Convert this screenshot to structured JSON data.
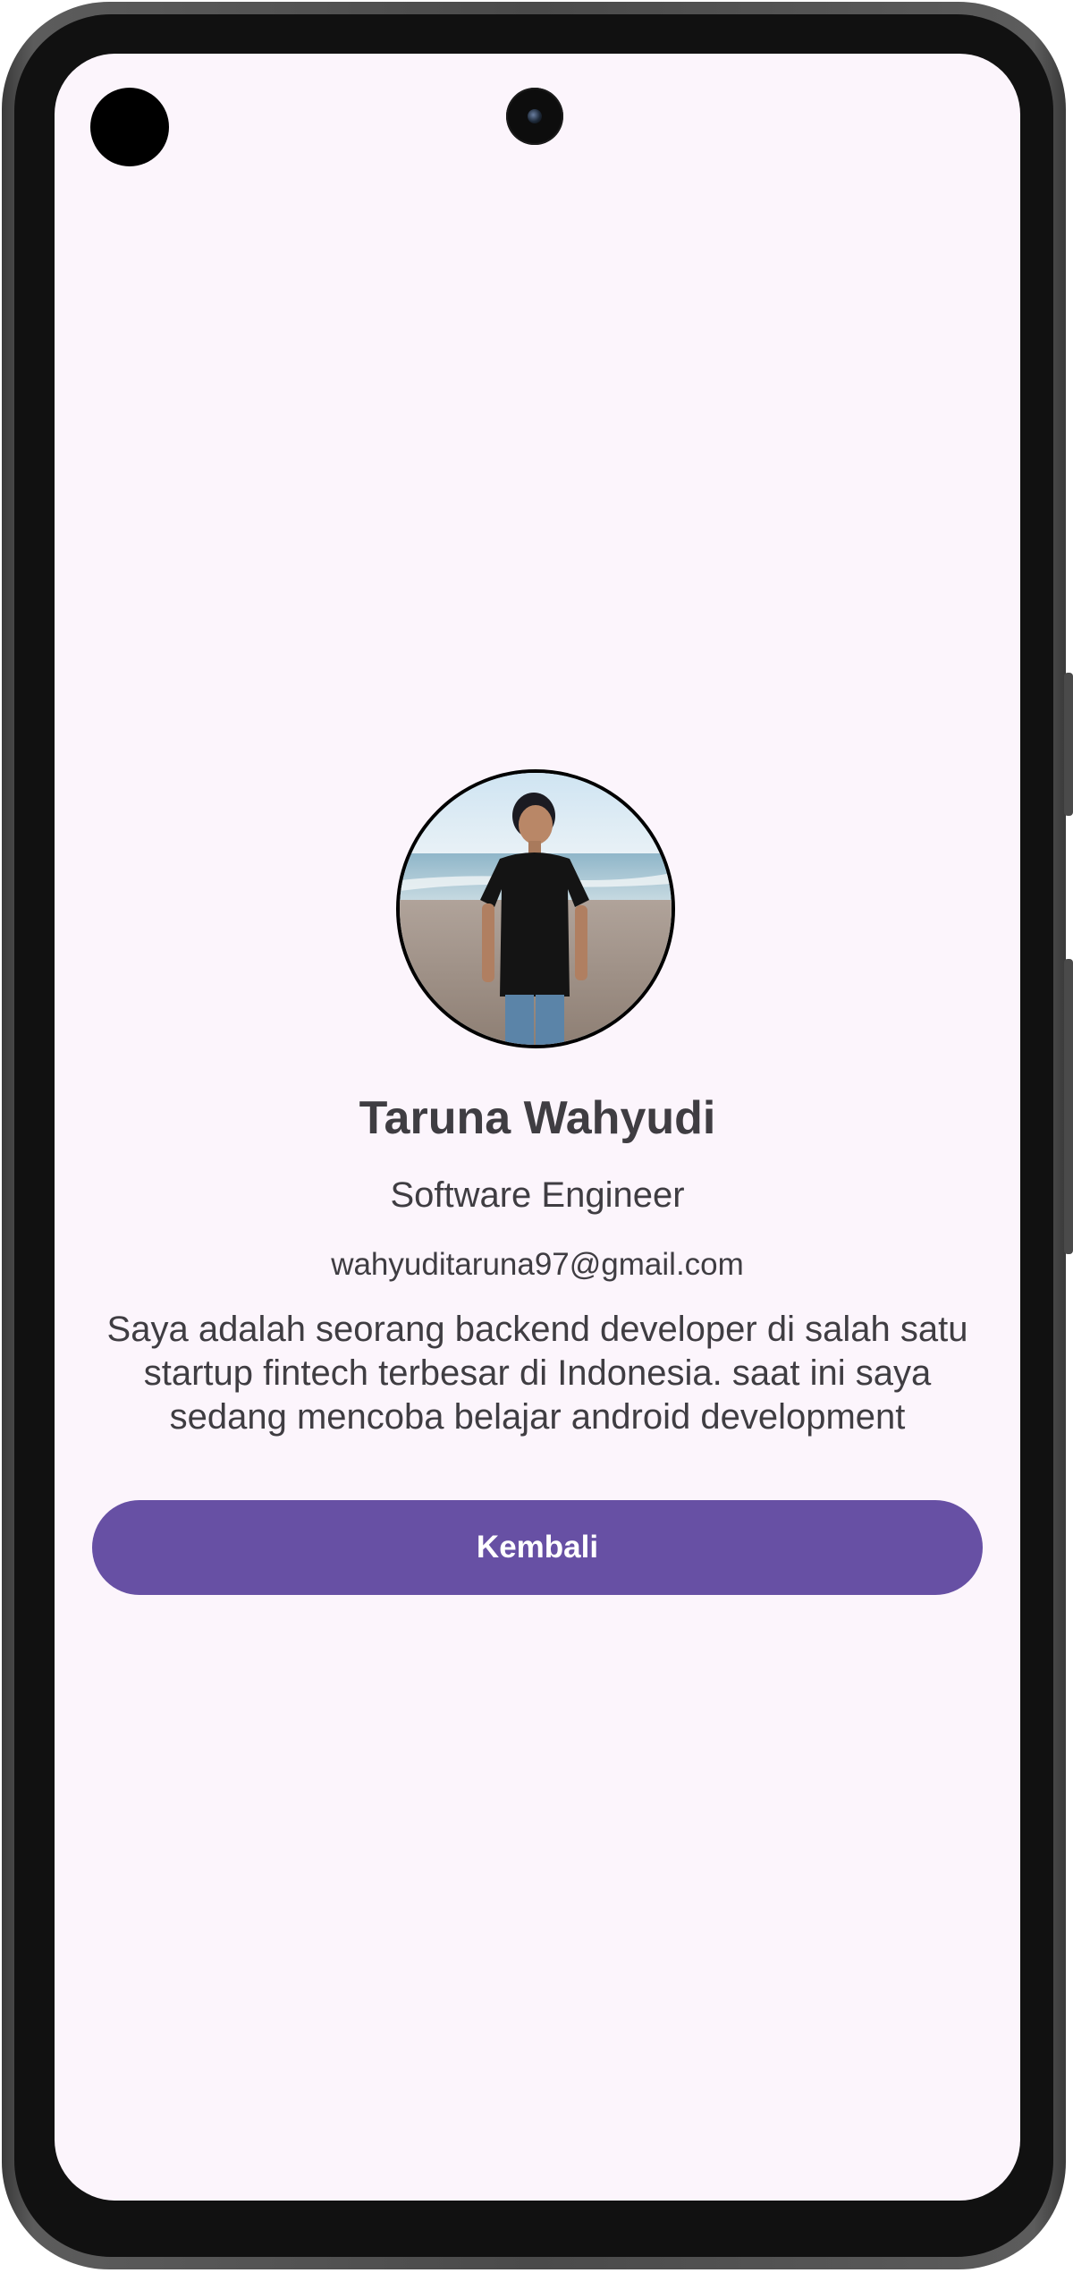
{
  "profile": {
    "name": "Taruna Wahyudi",
    "role": "Software Engineer",
    "email": "wahyuditaruna97@gmail.com",
    "bio": "Saya adalah seorang backend developer di salah satu startup fintech terbesar di Indonesia. saat ini saya sedang mencoba belajar android development"
  },
  "actions": {
    "back_label": "Kembali"
  },
  "colors": {
    "screen_background": "#fcf5fc",
    "text": "#3f3d42",
    "button": "#6750a4",
    "button_text": "#ffffff"
  }
}
